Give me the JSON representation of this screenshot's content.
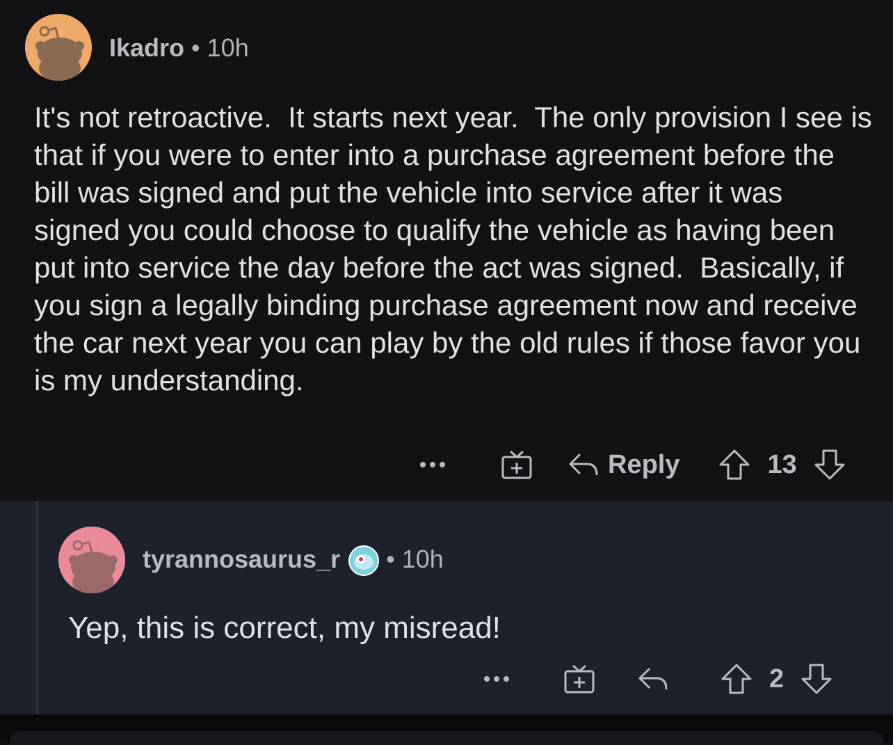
{
  "comments": [
    {
      "username": "Ikadro",
      "time": "10h",
      "avatar_color": "#f0a868",
      "body": "It's not retroactive.  It starts next year.  The only provision I see is that if you were to enter into a purchase agreement before the bill was signed and put the vehicle into service after it was signed you could choose to qualify the vehicle as having been put into service the day before the act was signed.  Basically, if you sign a legally binding purchase agreement now and receive the car next year you can play by the old rules if those favor you is my understanding.",
      "actions": {
        "more_icon": "ellipsis-icon",
        "award_icon": "gift-icon",
        "reply_label": "Reply",
        "upvotes": "13"
      }
    },
    {
      "username": "tyrannosaurus_r",
      "time": "10h",
      "avatar_color": "#e98a98",
      "badge_icon": "snoo-badge-icon",
      "body": "Yep, this is correct, my misread!",
      "actions": {
        "more_icon": "ellipsis-icon",
        "award_icon": "gift-icon",
        "upvotes": "2"
      }
    }
  ],
  "colors": {
    "background": "#121214",
    "reply_background": "#1c212b",
    "text": "#dfe1e4",
    "muted": "#b8bcc2"
  }
}
